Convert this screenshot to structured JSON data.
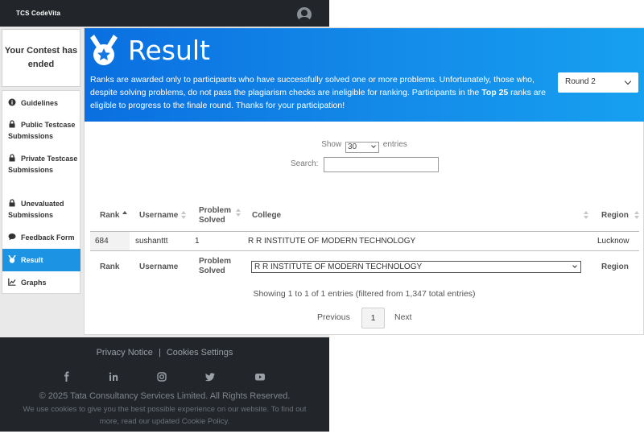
{
  "header": {
    "brand_prefix": "TCS",
    "brand_name": "CodeVita"
  },
  "sidebar": {
    "contest_status": "Your Contest has ended",
    "items": [
      {
        "label": "Guidelines",
        "icon": "info-icon"
      },
      {
        "label": "Public Testcase Submissions",
        "icon": "lock-icon"
      },
      {
        "label": "Private Testcase Submissions",
        "icon": "lock-icon"
      },
      {
        "label": "Unevaluated Submissions",
        "icon": "lock-icon"
      },
      {
        "label": "Feedback Form",
        "icon": "chat-icon"
      },
      {
        "label": "Result",
        "icon": "medal-icon",
        "active": true
      },
      {
        "label": "Graphs",
        "icon": "chart-icon"
      }
    ]
  },
  "banner": {
    "title": "Result",
    "text_part1": "Ranks are awarded only to participants who have successfully solved one or more problems. Unfortunately, those who, despite solving problems, do not pass the plagiarism checks are ineligible for ranking. Participants in the ",
    "text_bold": "Top 25",
    "text_part2": " ranks are eligible to progress to the finale round. Thanks for your participation!",
    "round_value": "Round 2"
  },
  "table_controls": {
    "show_label": "Show",
    "entries_value": "30",
    "entries_label": "entries",
    "search_label": "Search:",
    "search_value": ""
  },
  "table": {
    "columns": [
      "Rank",
      "Username",
      "Problem Solved",
      "College",
      "Region"
    ],
    "rows": [
      {
        "rank": "684",
        "username": "sushanttt",
        "solved": "1",
        "college": "R R INSTITUTE OF MODERN TECHNOLOGY",
        "region": "Lucknow"
      }
    ],
    "filter_college_value": "R R INSTITUTE OF MODERN TECHNOLOGY",
    "info": "Showing 1 to 1 of 1 entries (filtered from 1,347 total entries)",
    "pager": {
      "previous": "Previous",
      "page": "1",
      "next": "Next"
    }
  },
  "footer": {
    "privacy": "Privacy Notice",
    "separator": "|",
    "cookies": "Cookies Settings",
    "social": [
      "facebook-icon",
      "linkedin-icon",
      "instagram-icon",
      "twitter-icon",
      "youtube-icon"
    ],
    "copyright": "© 2025 Tata Consultancy Services Limited. All Rights Reserved.",
    "cookie_note": "We use cookies to give you the best possible experience on our website. To find out more, read our updated Cookie Policy."
  }
}
